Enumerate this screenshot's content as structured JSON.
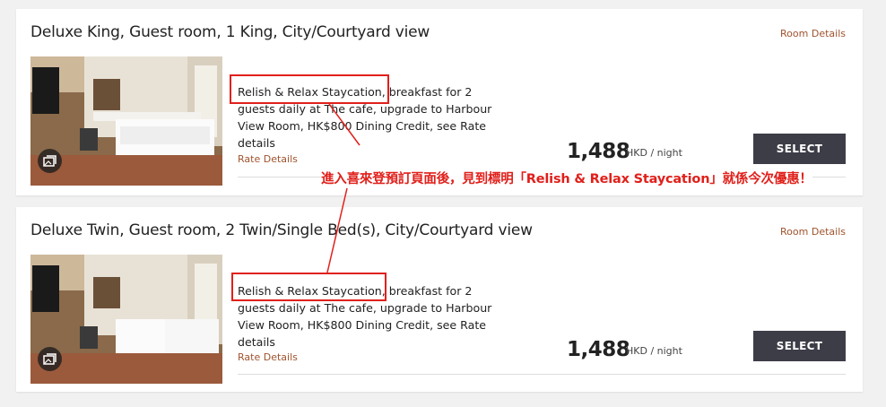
{
  "rooms": [
    {
      "title": "Deluxe King, Guest room, 1 King, City/Courtyard view",
      "details_link": "Room Details",
      "rate_name": "Relish & Relax Staycation",
      "rate_rest": ", breakfast for 2 guests daily at The cafe, upgrade to Harbour View Room, HK$800 Dining Credit, see Rate details",
      "rate_details_link": "Rate Details",
      "price": "1,488",
      "price_unit": "HKD / night",
      "select_label": "SELECT",
      "bed_type": "king"
    },
    {
      "title": "Deluxe Twin, Guest room, 2 Twin/Single Bed(s), City/Courtyard view",
      "details_link": "Room Details",
      "rate_name": "Relish & Relax Staycation",
      "rate_rest": ", breakfast for 2 guests daily at The cafe, upgrade to Harbour View Room, HK$800 Dining Credit, see Rate details",
      "rate_details_link": "Rate Details",
      "price": "1,488",
      "price_unit": "HKD / night",
      "select_label": "SELECT",
      "bed_type": "twin"
    }
  ],
  "annotation": "進入喜來登預訂頁面後，見到標明「Relish & Relax Staycation」就係今次優惠！",
  "colors": {
    "annotation_red": "#e0201b",
    "link_brown": "#a0522d",
    "select_button": "#3d3d48"
  },
  "icons": {
    "gallery": "gallery-icon"
  }
}
